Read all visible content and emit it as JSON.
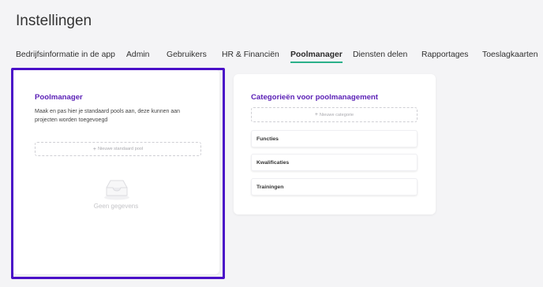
{
  "header": {
    "title": "Instellingen"
  },
  "tabs": [
    {
      "label": "Bedrijfsinformatie in de app",
      "active": false
    },
    {
      "label": "Admin",
      "active": false
    },
    {
      "label": "Gebruikers",
      "active": false
    },
    {
      "label": "HR & Financiën",
      "active": false
    },
    {
      "label": "Poolmanager",
      "active": true
    },
    {
      "label": "Diensten delen",
      "active": false
    },
    {
      "label": "Rapportages",
      "active": false
    },
    {
      "label": "Toeslagkaarten",
      "active": false
    }
  ],
  "poolmanager": {
    "title": "Poolmanager",
    "description": "Maak en pas hier je standaard pools aan, deze kunnen aan projecten worden toegevoegd",
    "new_pool_label": "Nieuwe standaard pool",
    "empty_text": "Geen gegevens",
    "empty_icon": "inbox-icon"
  },
  "categories": {
    "title": "Categorieën voor poolmanagement",
    "new_category_label": "Nieuwe categorie",
    "items": [
      "Functies",
      "Kwalificaties",
      "Trainingen"
    ]
  },
  "colors": {
    "accent_purple": "#5b21b6",
    "focus_frame": "#4a10c8",
    "active_tab_underline": "#2bb08a",
    "background": "#f4f4f6"
  }
}
